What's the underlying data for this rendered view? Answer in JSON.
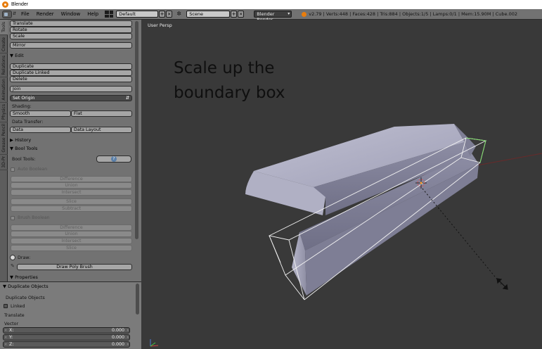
{
  "window": {
    "title": "Blender"
  },
  "menu": [
    "File",
    "Render",
    "Window",
    "Help"
  ],
  "header": {
    "screen_layout": "Default",
    "scene": "Scene",
    "render_engine": "Blender Render",
    "stats": "v2.79 | Verts:448 | Faces:428 | Tris:884 | Objects:1/5 | Lamps:0/1 | Mem:15.90M | Cube.002"
  },
  "tabs": [
    "Tools",
    "Create",
    "Relations",
    "Animation",
    "Physics",
    "Grease Pencil",
    "3D-Pr"
  ],
  "tool_shelf": {
    "transform_buttons": [
      "Translate",
      "Rotate",
      "Scale"
    ],
    "mirror": "Mirror",
    "edit_header": "Edit",
    "edit_buttons": [
      "Duplicate",
      "Duplicate Linked",
      "Delete"
    ],
    "join": "Join",
    "set_origin": "Set Origin",
    "shading_label": "Shading:",
    "shading_buttons": [
      "Smooth",
      "Flat"
    ],
    "data_transfer_label": "Data Transfer:",
    "data_transfer_buttons": [
      "Data",
      "Data Layout"
    ],
    "history_header": "History",
    "bool_tools_header": "Bool Tools",
    "bool_tools_label": "Bool Tools:",
    "auto_boolean_label": "Auto Boolean",
    "auto_boolean_ops": [
      "Difference",
      "Union",
      "Intersect",
      "Slice",
      "Subtract"
    ],
    "brush_boolean_label": "Brush Boolean",
    "brush_boolean_ops": [
      "Difference",
      "Union",
      "Intersect",
      "Slice"
    ],
    "draw_label": "Draw:",
    "draw_poly_brush": "Draw Poly Brush",
    "properties_header": "Properties"
  },
  "operator_panel": {
    "header": "Duplicate Objects",
    "op_label": "Duplicate Objects",
    "linked_label": "Linked",
    "translate_label": "Translate",
    "vector_label": "Vector",
    "vector": [
      {
        "axis": "X:",
        "value": "0.000"
      },
      {
        "axis": "Y:",
        "value": "0.000"
      },
      {
        "axis": "Z:",
        "value": "0.000"
      }
    ]
  },
  "viewport": {
    "label": "User Persp",
    "caption": "Scale up the boundary box"
  },
  "colors": {
    "panel_bg": "#727272",
    "viewport_bg": "#393939",
    "mesh": "#a3a3b8",
    "bbox_wire": "#ffffff",
    "accent_orange": "#e87d0d"
  },
  "icons": [
    "blender-logo-icon",
    "editor-type-icon",
    "screen-layout-icon",
    "scene-icon",
    "info-icon",
    "eye-icon",
    "pencil-icon",
    "checkbox-icon",
    "chevron-right-icon",
    "chevron-down-icon"
  ]
}
